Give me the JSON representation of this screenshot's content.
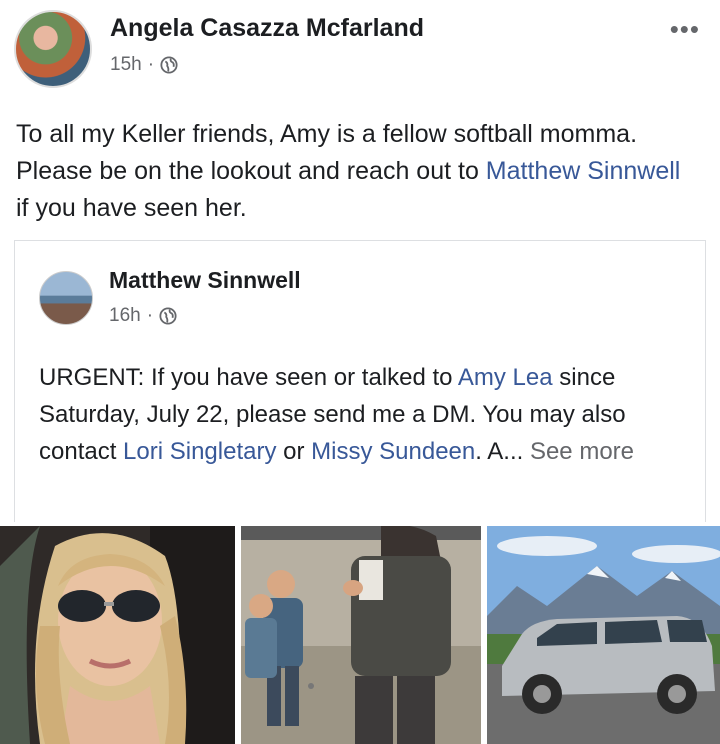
{
  "post": {
    "author": "Angela Casazza Mcfarland",
    "time": "15h",
    "separator": "·",
    "more_label": "•••",
    "text_part1": "To all my Keller friends, Amy is a fellow softball momma. Please be on the lookout and reach out to ",
    "text_link": "Matthew Sinnwell",
    "text_part2": " if you have seen her."
  },
  "shared": {
    "author": "Matthew Sinnwell",
    "time": "16h",
    "separator": "·",
    "t1": "URGENT:  If you have seen or talked to ",
    "l1": "Amy Lea",
    "t2": " since Saturday, July 22, please send me a DM.  You may also contact ",
    "l2": "Lori Singletary",
    "t3": " or ",
    "l3": "Missy Sundeen",
    "t4": ". A... ",
    "see_more": "See more"
  },
  "colors": {
    "link": "#385898",
    "meta": "#65676b",
    "text": "#1c1e21"
  }
}
